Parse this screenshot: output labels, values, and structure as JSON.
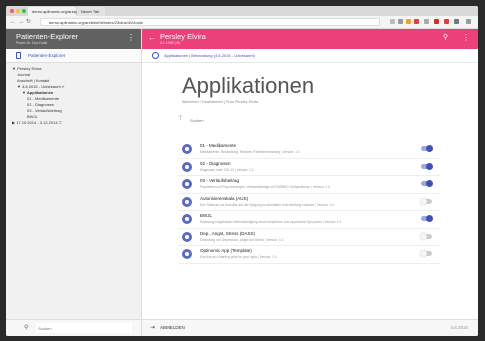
{
  "browser": {
    "tab_active": "demo.aplinamic.org/arztpraxis",
    "tab_second": "Neuer Tab",
    "url": "demo.aplinamic.org/arztbrief/#/index/23/dus/4/2/tools",
    "colors": {
      "traffic_red": "#fc5753",
      "traffic_yellow": "#fdbc40",
      "traffic_green": "#33c748"
    }
  },
  "sidebar": {
    "title": "Patienten-Explorer",
    "subtitle": "Praxis Dr. Doc Dokk",
    "tab_label": "Patienten-Explorer",
    "tree": [
      {
        "label": "Persley Elvira",
        "indent": 0,
        "prefix": "▼",
        "bold": false
      },
      {
        "label": "Journal",
        "indent": 1,
        "prefix": "",
        "bold": false
      },
      {
        "label": "Anschrift | Kontakt",
        "indent": 1,
        "prefix": "",
        "bold": false
      },
      {
        "label": "4.6.2015 - Unbekannt",
        "indent": 1,
        "prefix": "▼",
        "bold": false,
        "check": true
      },
      {
        "label": "Applikationen",
        "indent": 2,
        "prefix": "▼",
        "bold": true
      },
      {
        "label": "01 - Medikamente",
        "indent": 3,
        "prefix": "",
        "bold": false
      },
      {
        "label": "02 - Diagnosen",
        "indent": 3,
        "prefix": "",
        "bold": false
      },
      {
        "label": "03 - Verlaufsbeitrag",
        "indent": 3,
        "prefix": "",
        "bold": false
      },
      {
        "label": "BWJL",
        "indent": 3,
        "prefix": "",
        "bold": false
      },
      {
        "label": "17.10.2014 - 3.12.2014",
        "indent": 0,
        "prefix": "▶",
        "bold": false,
        "lock": true
      }
    ],
    "search_placeholder": "Suchen"
  },
  "main": {
    "patient_name": "Persley Elvira",
    "patient_id": "8.1.1960 | 61",
    "breadcrumb": "Applikationen | Behandlung (4.6.2015 - Unbekannt)",
    "page_title": "Applikationen",
    "page_subtitle": "Aktivieren / Deaktivieren | Frau Persley Elvira",
    "filter_placeholder": "Suchen",
    "apps": [
      {
        "title": "01 - Medikamente",
        "desc": "Medikamente, Behandlung, Rezepte, Patientenerklärung | Version: 1.0",
        "on": true
      },
      {
        "title": "02 - Diagnosen",
        "desc": "Diagnosen nach ICD-10 | Version: 1.0",
        "on": true
      },
      {
        "title": "03 - Verlaufsbeitrag",
        "desc": "Psychiatrie und Psychotherapie: Verlaufsbeiträge mit TARMED-Tarifpositionen | Version: 1.0",
        "on": true
      },
      {
        "title": "Autorisierenskala (AUS)",
        "desc": "Den Skalaum zur Autorität und der Neigung zu autoritärer Unterwerfung erfassen | Version: 1.0",
        "on": false
      },
      {
        "title": "BWJL",
        "desc": "Erfassung vorgefasster Beeinträchtigung durch körperliche und psychische Symptome | Version: 1.0",
        "on": true
      },
      {
        "title": "Dep., Angst, Stress (DASS)",
        "desc": "Einstufung von Depression, Angst und Stress | Version: 1.0",
        "on": false
      },
      {
        "title": "Optinomic App (Template)",
        "desc": "Use this as a starting point for your apps | Version: 1.0",
        "on": false
      }
    ],
    "logout_label": "ABMELDEN",
    "footer_date": "4.6.2015",
    "colors": {
      "header": "#ec407a",
      "accent": "#3f51b5"
    }
  }
}
